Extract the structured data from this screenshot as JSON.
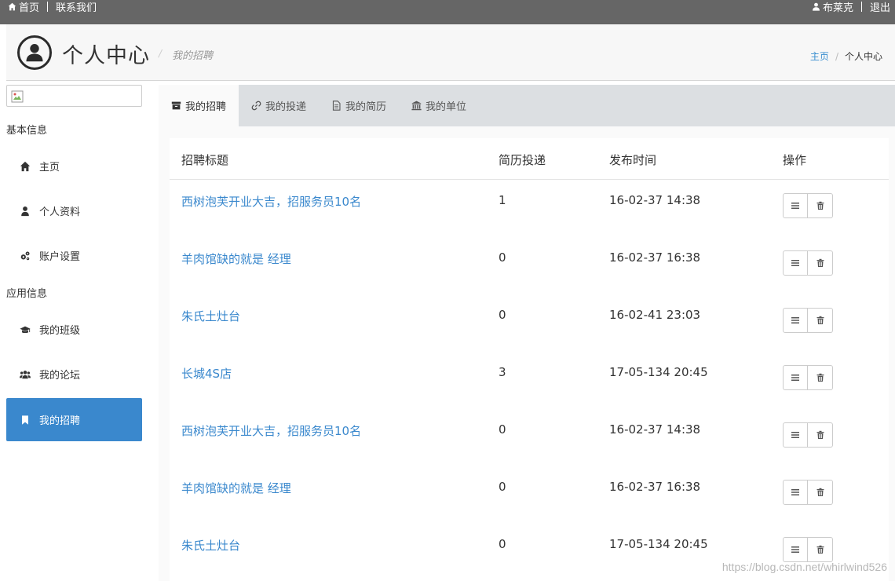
{
  "topbar": {
    "home": "首页",
    "contact": "联系我们",
    "user": "布莱克",
    "logout": "退出"
  },
  "header": {
    "title": "个人中心",
    "subtitle": "我的招聘",
    "crumb_home": "主页",
    "crumb_sep": "/",
    "crumb_current": "个人中心"
  },
  "sidebar": {
    "group_basic": "基本信息",
    "group_app": "应用信息",
    "items": [
      {
        "label": "主页",
        "icon": "home-icon"
      },
      {
        "label": "个人资料",
        "icon": "user-icon"
      },
      {
        "label": "账户设置",
        "icon": "cogs-icon"
      },
      {
        "label": "我的班级",
        "icon": "graduation-cap-icon"
      },
      {
        "label": "我的论坛",
        "icon": "users-icon"
      },
      {
        "label": "我的招聘",
        "icon": "bookmark-icon",
        "active": true
      }
    ]
  },
  "tabs": [
    {
      "label": "我的招聘",
      "icon": "archive-icon",
      "active": true
    },
    {
      "label": "我的投递",
      "icon": "link-icon"
    },
    {
      "label": "我的简历",
      "icon": "file-icon"
    },
    {
      "label": "我的单位",
      "icon": "bank-icon"
    }
  ],
  "table": {
    "columns": [
      "招聘标题",
      "简历投递",
      "发布时间",
      "操作"
    ],
    "rows": [
      {
        "title": "西树泡芙开业大吉，招服务员10名",
        "count": "1",
        "time": "16-02-37 14:38"
      },
      {
        "title": "羊肉馆缺的就是 经理",
        "count": "0",
        "time": "16-02-37 16:38"
      },
      {
        "title": "朱氏土灶台",
        "count": "0",
        "time": "16-02-41 23:03"
      },
      {
        "title": "长城4S店",
        "count": "3",
        "time": "17-05-134 20:45"
      },
      {
        "title": "西树泡芙开业大吉，招服务员10名",
        "count": "0",
        "time": "16-02-37 14:38"
      },
      {
        "title": "羊肉馆缺的就是 经理",
        "count": "0",
        "time": "16-02-37 16:38"
      },
      {
        "title": "朱氏土灶台",
        "count": "0",
        "time": "17-05-134 20:45"
      }
    ]
  },
  "watermark": "https://blog.csdn.net/whirlwind526",
  "colors": {
    "accent": "#3a88cd",
    "topbar": "#666666",
    "tabbar": "#dcdfe2"
  }
}
